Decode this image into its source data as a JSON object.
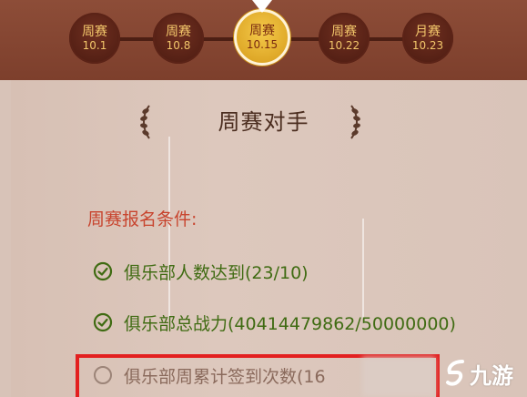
{
  "timeline": {
    "nodes": [
      {
        "name": "周赛",
        "date": "10.1",
        "active": false
      },
      {
        "name": "周赛",
        "date": "10.8",
        "active": false
      },
      {
        "name": "周赛",
        "date": "10.15",
        "active": true
      },
      {
        "name": "周赛",
        "date": "10.22",
        "active": false
      },
      {
        "name": "月赛",
        "date": "10.23",
        "active": false
      }
    ]
  },
  "section": {
    "title": "周赛对手"
  },
  "conditions": {
    "header": "周赛报名条件:",
    "items": [
      {
        "text": "俱乐部人数达到(23/10)",
        "status": "met"
      },
      {
        "text": "俱乐部总战力(40414479862/50000000)",
        "status": "met"
      },
      {
        "text": "俱乐部周累计签到次数(16",
        "status": "unmet"
      }
    ]
  },
  "watermark": {
    "text": "九游"
  },
  "colors": {
    "band": "#7d3f2c",
    "node_active": "#e8b52c",
    "met_green": "#3f6b12",
    "header_red": "#c8442e",
    "highlight_red": "#e32020"
  }
}
